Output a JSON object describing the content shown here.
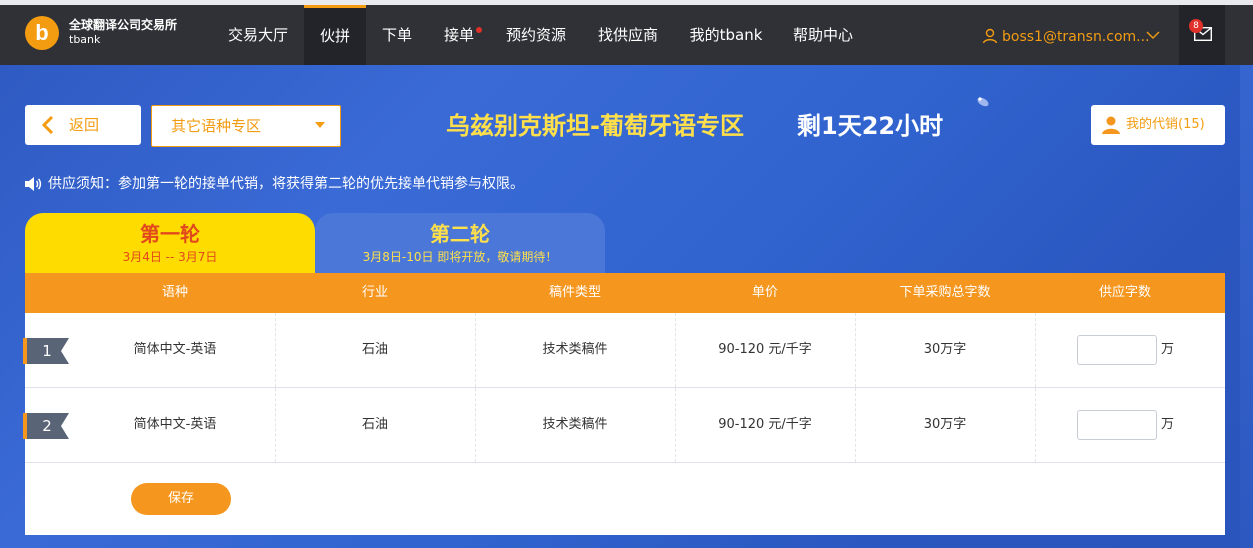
{
  "header": {
    "logo_letter": "b",
    "logo_title": "全球翻译公司交易所",
    "logo_subtitle": "tbank",
    "nav": [
      {
        "label": "交易大厅"
      },
      {
        "label": "伙拼"
      },
      {
        "label": "下单"
      },
      {
        "label": "接单"
      },
      {
        "label": "预约资源"
      },
      {
        "label": "找供应商"
      },
      {
        "label": "我的tbank"
      },
      {
        "label": "帮助中心"
      }
    ],
    "active_nav": "伙拼",
    "user": "boss1@transn.com...",
    "mail_badge": "8"
  },
  "toolbar": {
    "back_label": "返回",
    "select_value": "其它语种专区",
    "zone_title": "乌兹别克斯坦-葡萄牙语专区",
    "time_left": "剩1天22小时",
    "agency_label": "我的代销(15)"
  },
  "notice": {
    "text": "供应须知：参加第一轮的接单代销，将获得第二轮的优先接单代销参与权限。"
  },
  "tabs": [
    {
      "title": "第一轮",
      "date": "3月4日 -- 3月7日"
    },
    {
      "title": "第二轮",
      "date": "3月8日-10日 即将开放，敬请期待！"
    }
  ],
  "table": {
    "headers": [
      "语种",
      "行业",
      "稿件类型",
      "单价",
      "下单采购总字数",
      "供应字数"
    ],
    "rows": [
      {
        "num": "1",
        "lang": "简体中文-英语",
        "industry": "石油",
        "type": "技术类稿件",
        "price": "90-120 元/千字",
        "total": "30万字",
        "supply": "",
        "unit": "万"
      },
      {
        "num": "2",
        "lang": "简体中文-英语",
        "industry": "石油",
        "type": "技术类稿件",
        "price": "90-120 元/千字",
        "total": "30万字",
        "supply": "",
        "unit": "万"
      }
    ],
    "save_label": "保存"
  },
  "colors": {
    "accent": "#f39c12",
    "header_bg": "#2f3136",
    "tab_active": "#fedc00",
    "table_header": "#f5961e"
  }
}
